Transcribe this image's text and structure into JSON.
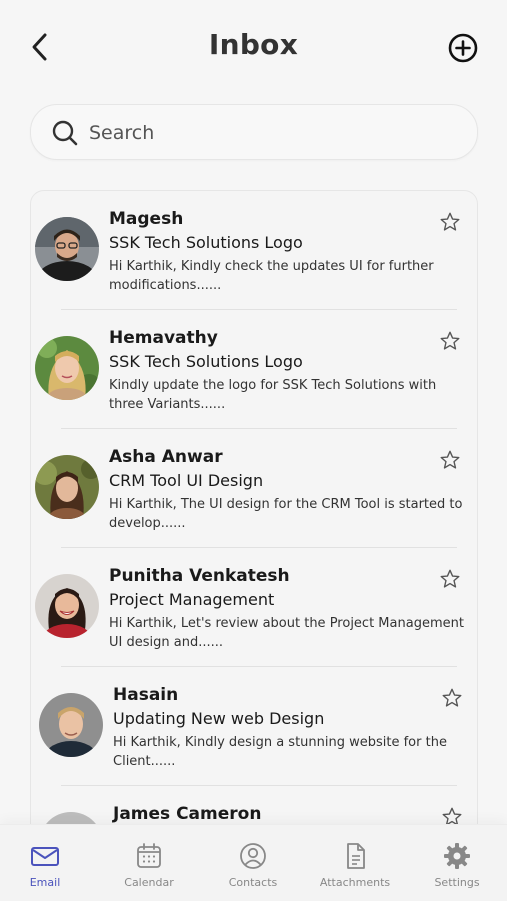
{
  "header": {
    "title": "Inbox",
    "back_icon": "chevron-left-icon",
    "add_icon": "plus-circle-icon"
  },
  "search": {
    "placeholder": "Search",
    "value": "",
    "icon": "search-icon"
  },
  "messages": [
    {
      "sender": "Magesh",
      "subject": "SSK Tech Solutions Logo",
      "preview": "Hi Karthik, Kindly check the updates UI for further modifications......",
      "starred": false
    },
    {
      "sender": "Hemavathy",
      "subject": "SSK Tech Solutions Logo",
      "preview": "Kindly update the logo for SSK Tech Solutions with three Variants......",
      "starred": false
    },
    {
      "sender": "Asha Anwar",
      "subject": "CRM Tool UI Design",
      "preview": "Hi Karthik, The UI design for the CRM Tool is started to develop......",
      "starred": false
    },
    {
      "sender": "Punitha Venkatesh",
      "subject": "Project Management",
      "preview": "Hi Karthik, Let's review about the Project Management UI design and......",
      "starred": false
    },
    {
      "sender": "Hasain",
      "subject": "Updating New web Design",
      "preview": "Hi Karthik, Kindly design a stunning website for the Client......",
      "starred": false
    },
    {
      "sender": "James Cameron",
      "subject": "",
      "preview": "",
      "starred": false
    }
  ],
  "nav": [
    {
      "label": "Email",
      "icon": "mail-icon",
      "active": true
    },
    {
      "label": "Calendar",
      "icon": "calendar-icon",
      "active": false
    },
    {
      "label": "Contacts",
      "icon": "user-circle-icon",
      "active": false
    },
    {
      "label": "Attachments",
      "icon": "document-icon",
      "active": false
    },
    {
      "label": "Settings",
      "icon": "gear-icon",
      "active": false
    }
  ],
  "colors": {
    "accent": "#4b53bc",
    "background": "#f6f6f6",
    "text": "#1a1a1a",
    "muted": "#888888"
  }
}
